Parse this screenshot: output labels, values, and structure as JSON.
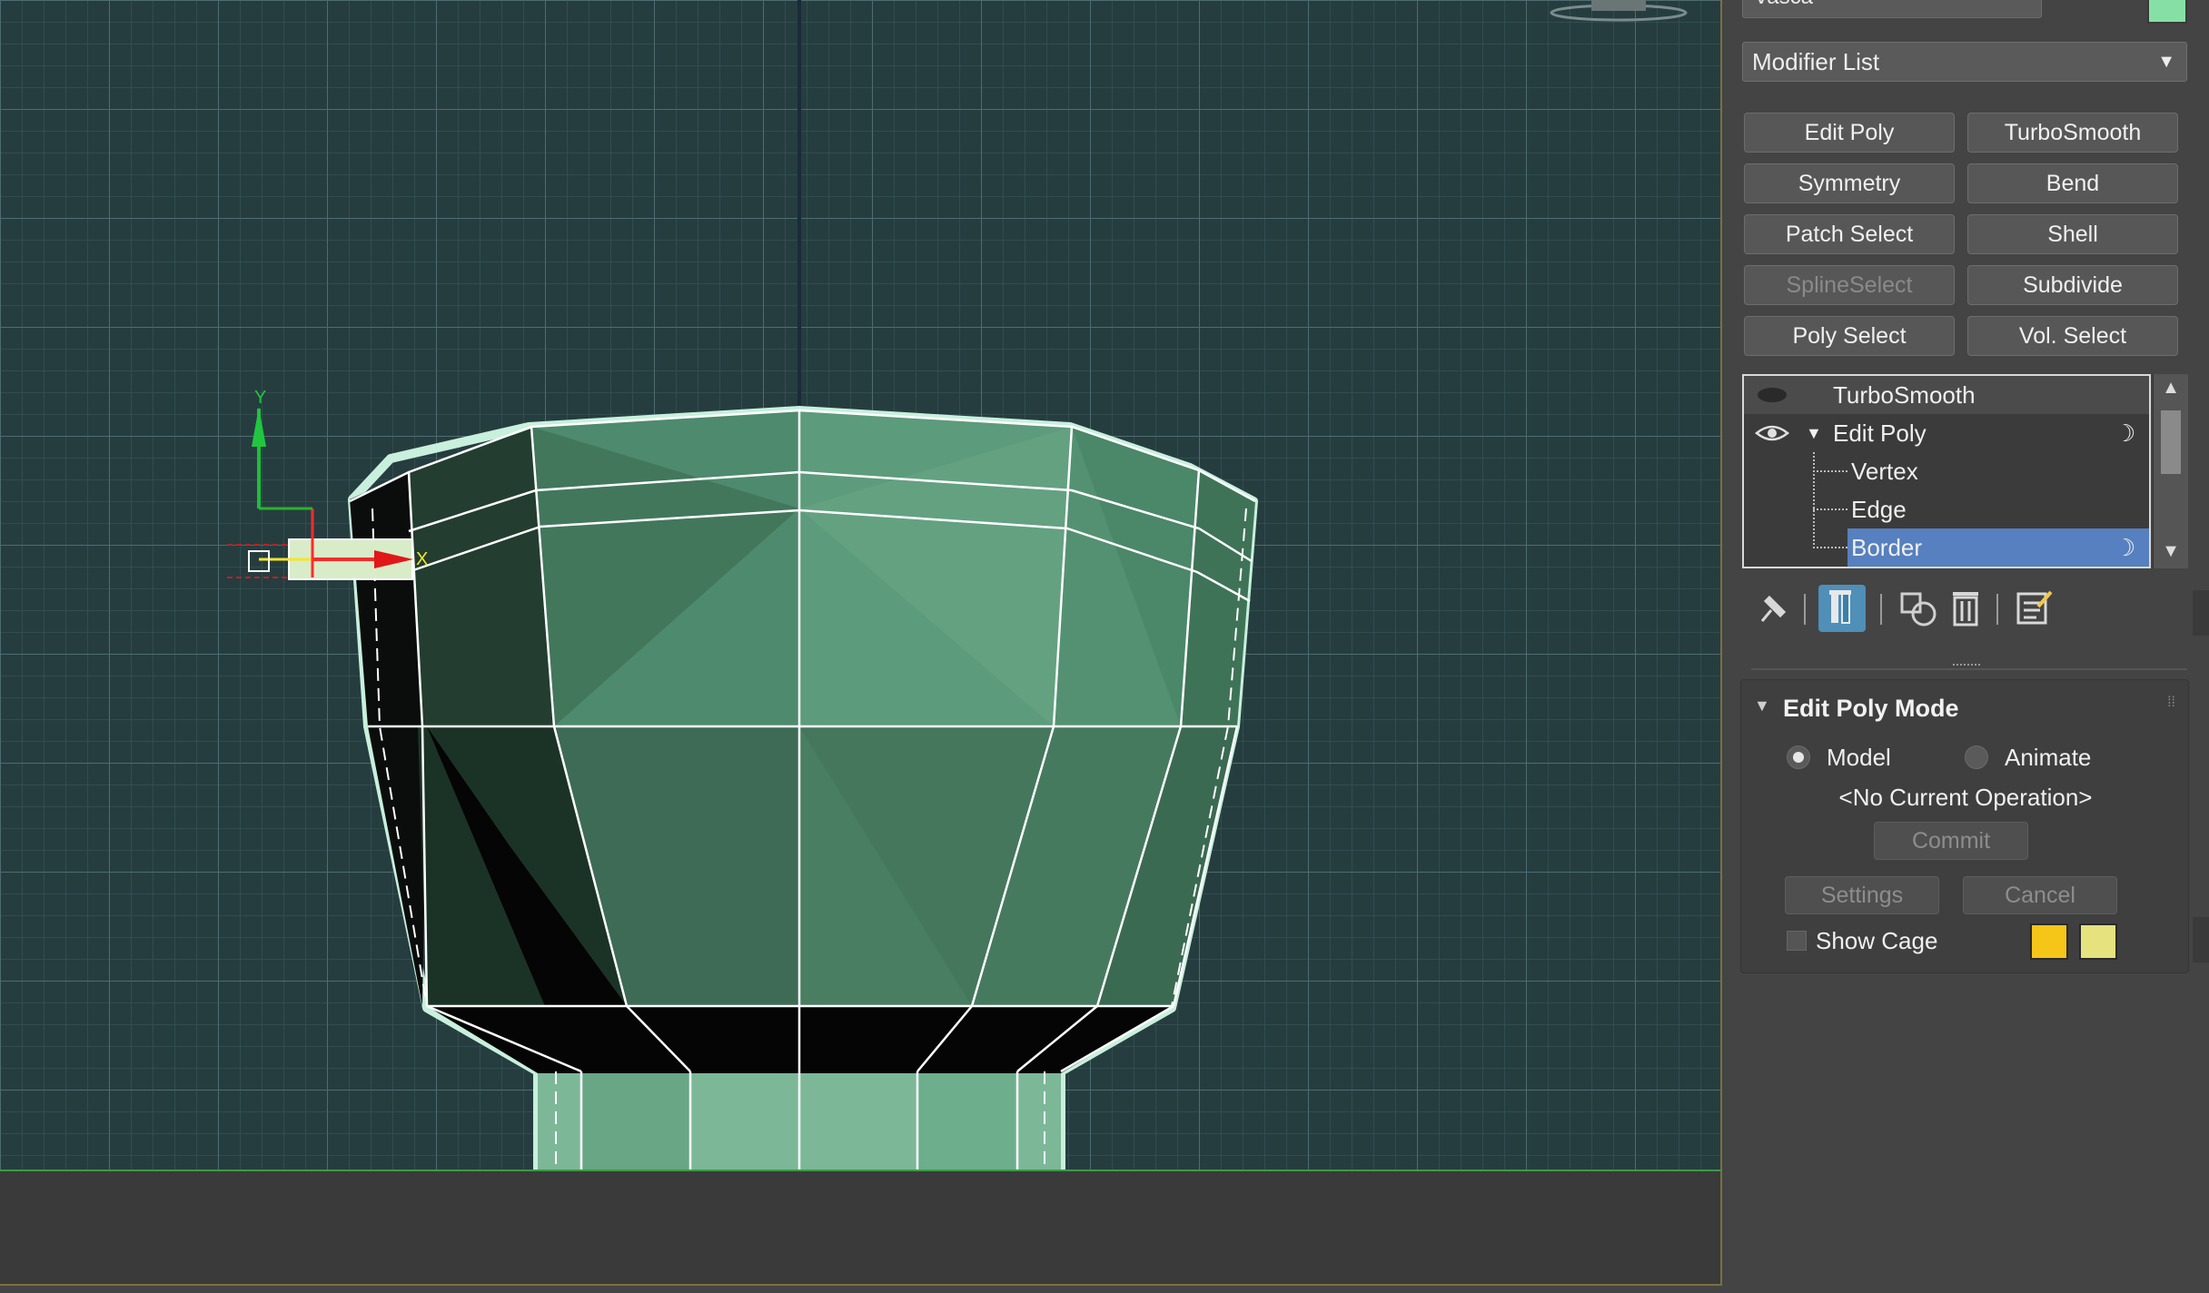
{
  "object_name": "Vasca",
  "object_color": "#86e0a6",
  "modifier_dropdown": "Modifier List",
  "modifier_buttons": [
    {
      "label": "Edit Poly",
      "enabled": true
    },
    {
      "label": "TurboSmooth",
      "enabled": true
    },
    {
      "label": "Symmetry",
      "enabled": true
    },
    {
      "label": "Bend",
      "enabled": true
    },
    {
      "label": "Patch Select",
      "enabled": true
    },
    {
      "label": "Shell",
      "enabled": true
    },
    {
      "label": "SplineSelect",
      "enabled": false
    },
    {
      "label": "Subdivide",
      "enabled": true
    },
    {
      "label": "Poly Select",
      "enabled": true
    },
    {
      "label": "Vol. Select",
      "enabled": true
    }
  ],
  "stack": {
    "items": [
      "TurboSmooth",
      "Edit Poly",
      "Vertex",
      "Edge",
      "Border"
    ],
    "selected": "Border"
  },
  "toolbar_icons": [
    "pin-stack-icon",
    "show-end-result-icon",
    "make-unique-icon",
    "remove-modifier-icon",
    "configure-modifier-sets-icon"
  ],
  "edit_poly_mode": {
    "title": "Edit Poly Mode",
    "model_label": "Model",
    "animate_label": "Animate",
    "mode": "Model",
    "current_operation": "<No Current Operation>",
    "commit_label": "Commit",
    "settings_label": "Settings",
    "cancel_label": "Cancel",
    "show_cage_label": "Show Cage",
    "cage_colors": [
      "#f5c518",
      "#e6e27e"
    ]
  },
  "gizmo": {
    "x_label": "X",
    "y_label": "Y"
  },
  "colors": {
    "viewport_bg": "#263d40",
    "mesh": "#5fa283",
    "selection_blue": "#5680bf",
    "active_tool": "#4f8fb8"
  }
}
